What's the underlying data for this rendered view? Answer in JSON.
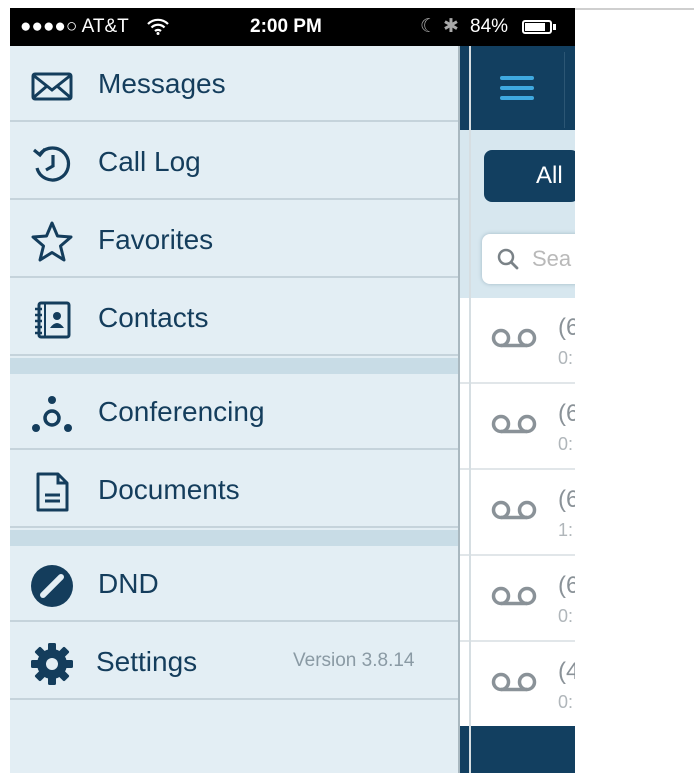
{
  "status_bar": {
    "carrier": "●●●●○ AT&T",
    "wifi_icon": "wifi-icon",
    "time": "2:00 PM",
    "moon": "☾",
    "bluetooth": "✱",
    "battery": "84%",
    "battery_level": 0.84
  },
  "menu": {
    "items": [
      {
        "label": "Messages",
        "icon": "envelope-icon"
      },
      {
        "label": "Call Log",
        "icon": "clock-history-icon"
      },
      {
        "label": "Favorites",
        "icon": "star-icon"
      },
      {
        "label": "Contacts",
        "icon": "address-book-icon"
      },
      {
        "label": "Conferencing",
        "icon": "conference-icon"
      },
      {
        "label": "Documents",
        "icon": "document-icon"
      },
      {
        "label": "DND",
        "icon": "dnd-icon"
      },
      {
        "label": "Settings",
        "icon": "gear-icon"
      }
    ],
    "version": "Version 3.8.14"
  },
  "panel": {
    "menu_icon": "hamburger-icon",
    "segment_label": "All",
    "search_placeholder": "Sea",
    "rows": [
      {
        "number": "(6",
        "duration": "0:"
      },
      {
        "number": "(6",
        "duration": "0:"
      },
      {
        "number": "(6",
        "duration": "1:"
      },
      {
        "number": "(6",
        "duration": "0:"
      },
      {
        "number": "(4",
        "duration": "0:"
      }
    ],
    "row_icon": "voicemail-icon"
  },
  "colors": {
    "navy": "#123f60",
    "menu_bg": "#e3eef4",
    "accent": "#3fa9e0"
  }
}
